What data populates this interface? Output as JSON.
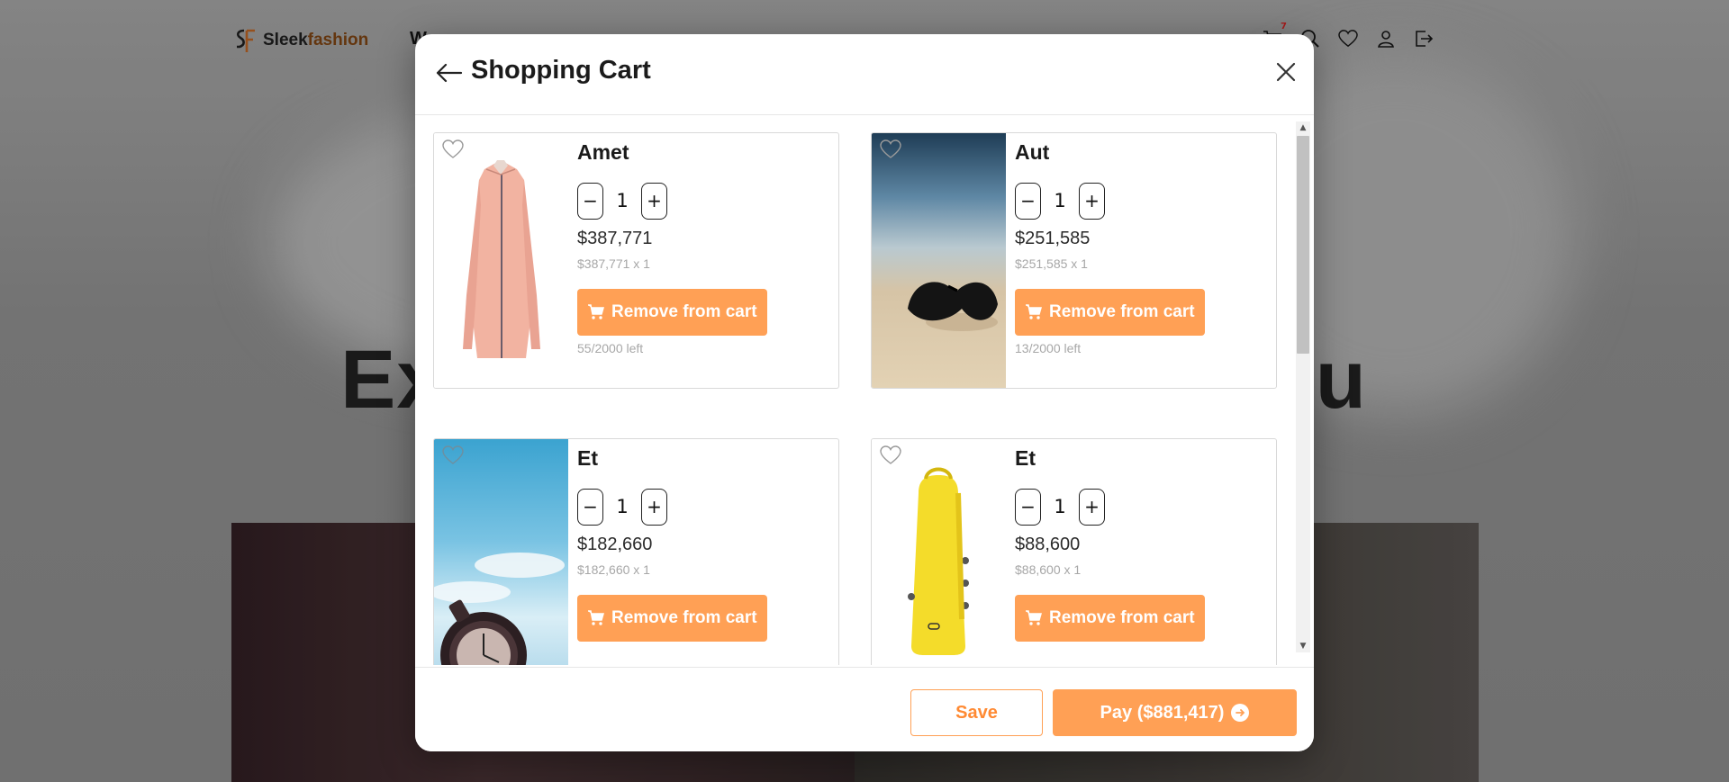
{
  "background": {
    "brand": {
      "name_part1": "Sleek",
      "name_part2": "fashion"
    },
    "nav_peek": "W",
    "cart_badge": "7",
    "hero_left": "Ex",
    "hero_right": "ou"
  },
  "modal": {
    "title": "Shopping Cart",
    "items": [
      {
        "name": "Amet",
        "quantity": "1",
        "price": "$387,771",
        "subtotal": "$387,771 x 1",
        "remove_label": "Remove from cart",
        "stock": "55/2000 left",
        "image": "pink-shirt"
      },
      {
        "name": "Aut",
        "quantity": "1",
        "price": "$251,585",
        "subtotal": "$251,585 x 1",
        "remove_label": "Remove from cart",
        "stock": "13/2000 left",
        "image": "sunglasses-on-sand"
      },
      {
        "name": "Et",
        "quantity": "1",
        "price": "$182,660",
        "subtotal": "$182,660 x 1",
        "remove_label": "Remove from cart",
        "stock": "",
        "image": "wristwatch-sky"
      },
      {
        "name": "Et",
        "quantity": "1",
        "price": "$88,600",
        "subtotal": "$88,600 x 1",
        "remove_label": "Remove from cart",
        "stock": "",
        "image": "yellow-backpack"
      }
    ],
    "footer": {
      "save_label": "Save",
      "pay_label": "Pay ($881,417)"
    }
  },
  "colors": {
    "accent": "#ffa055",
    "accent_text": "#ff8a33"
  }
}
